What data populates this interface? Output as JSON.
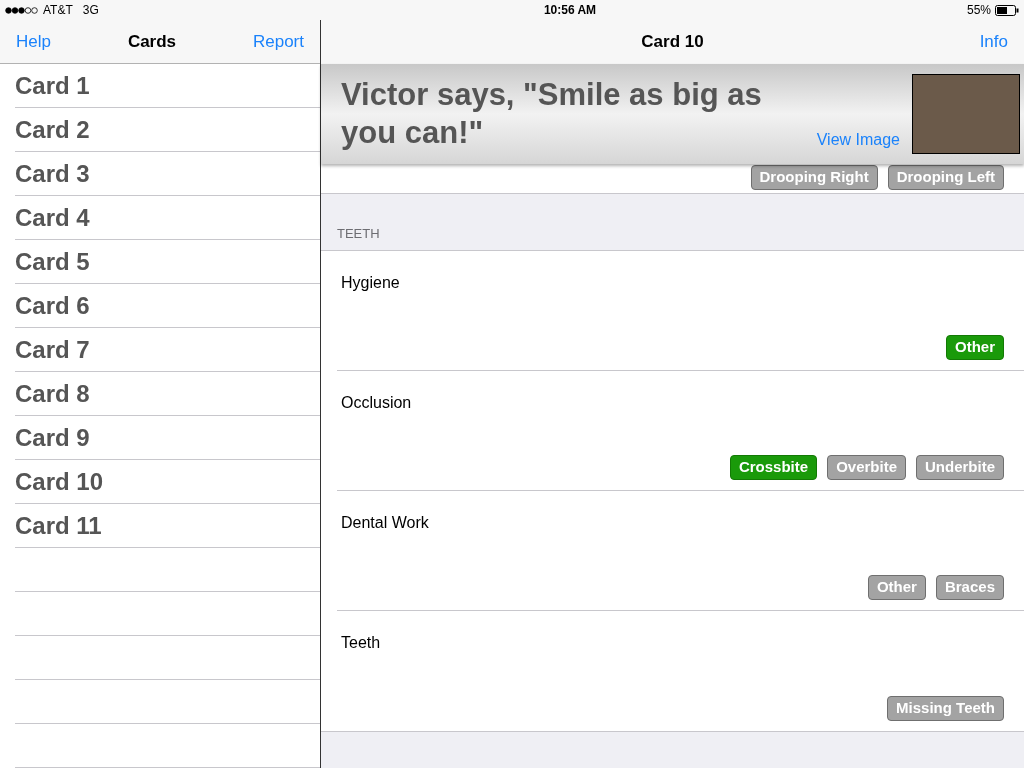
{
  "status_bar": {
    "carrier": "AT&T",
    "network": "3G",
    "time": "10:56 AM",
    "battery": "55%"
  },
  "sidebar": {
    "nav": {
      "left": "Help",
      "title": "Cards",
      "right": "Report"
    },
    "items": [
      {
        "label": "Card 1"
      },
      {
        "label": "Card 2"
      },
      {
        "label": "Card 3"
      },
      {
        "label": "Card 4"
      },
      {
        "label": "Card 5"
      },
      {
        "label": "Card 6"
      },
      {
        "label": "Card 7"
      },
      {
        "label": "Card 8"
      },
      {
        "label": "Card 9"
      },
      {
        "label": "Card 10"
      },
      {
        "label": "Card 11"
      }
    ]
  },
  "detail": {
    "nav": {
      "title": "Card 10",
      "right": "Info"
    },
    "banner": {
      "text": "Victor says, \"Smile as big as you can!\"",
      "link": "View Image"
    },
    "partial_options": [
      {
        "label": "Drooping Right",
        "selected": false
      },
      {
        "label": "Drooping Left",
        "selected": false
      }
    ],
    "section": "TEETH",
    "rows": [
      {
        "label": "Hygiene",
        "options": [
          {
            "label": "Other",
            "selected": true
          }
        ]
      },
      {
        "label": "Occlusion",
        "options": [
          {
            "label": "Crossbite",
            "selected": true
          },
          {
            "label": "Overbite",
            "selected": false
          },
          {
            "label": "Underbite",
            "selected": false
          }
        ]
      },
      {
        "label": "Dental Work",
        "options": [
          {
            "label": "Other",
            "selected": false
          },
          {
            "label": "Braces",
            "selected": false
          }
        ]
      },
      {
        "label": "Teeth",
        "options": [
          {
            "label": "Missing Teeth",
            "selected": false
          }
        ]
      }
    ]
  }
}
